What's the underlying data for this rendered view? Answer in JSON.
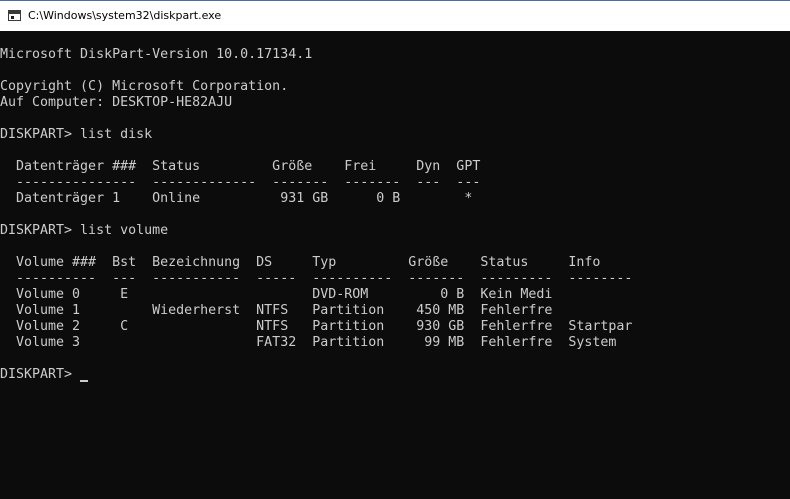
{
  "window": {
    "title": "C:\\Windows\\system32\\diskpart.exe",
    "icon": "console-app-icon"
  },
  "console": {
    "background": "#0c0c0c",
    "foreground": "#cccccc",
    "lines": [
      "Microsoft DiskPart-Version 10.0.17134.1",
      "",
      "Copyright (C) Microsoft Corporation.",
      "Auf Computer: DESKTOP-HE82AJU",
      "",
      "DISKPART> list disk",
      "",
      "  Datenträger ###  Status         Größe    Frei     Dyn  GPT",
      "  ---------------  -------------  -------  -------  ---  ---",
      "  Datenträger 1    Online          931 GB      0 B        *",
      "",
      "DISKPART> list volume",
      "",
      "  Volume ###  Bst  Bezeichnung  DS     Typ         Größe    Status     Info",
      "  ----------  ---  -----------  -----  ----------  -------  ---------  --------",
      "  Volume 0     E                       DVD-ROM         0 B  Kein Medi",
      "  Volume 1         Wiederherst  NTFS   Partition    450 MB  Fehlerfre",
      "  Volume 2     C                NTFS   Partition    930 GB  Fehlerfre  Startpar",
      "  Volume 3                      FAT32  Partition     99 MB  Fehlerfre  System",
      "",
      "DISKPART> "
    ]
  }
}
